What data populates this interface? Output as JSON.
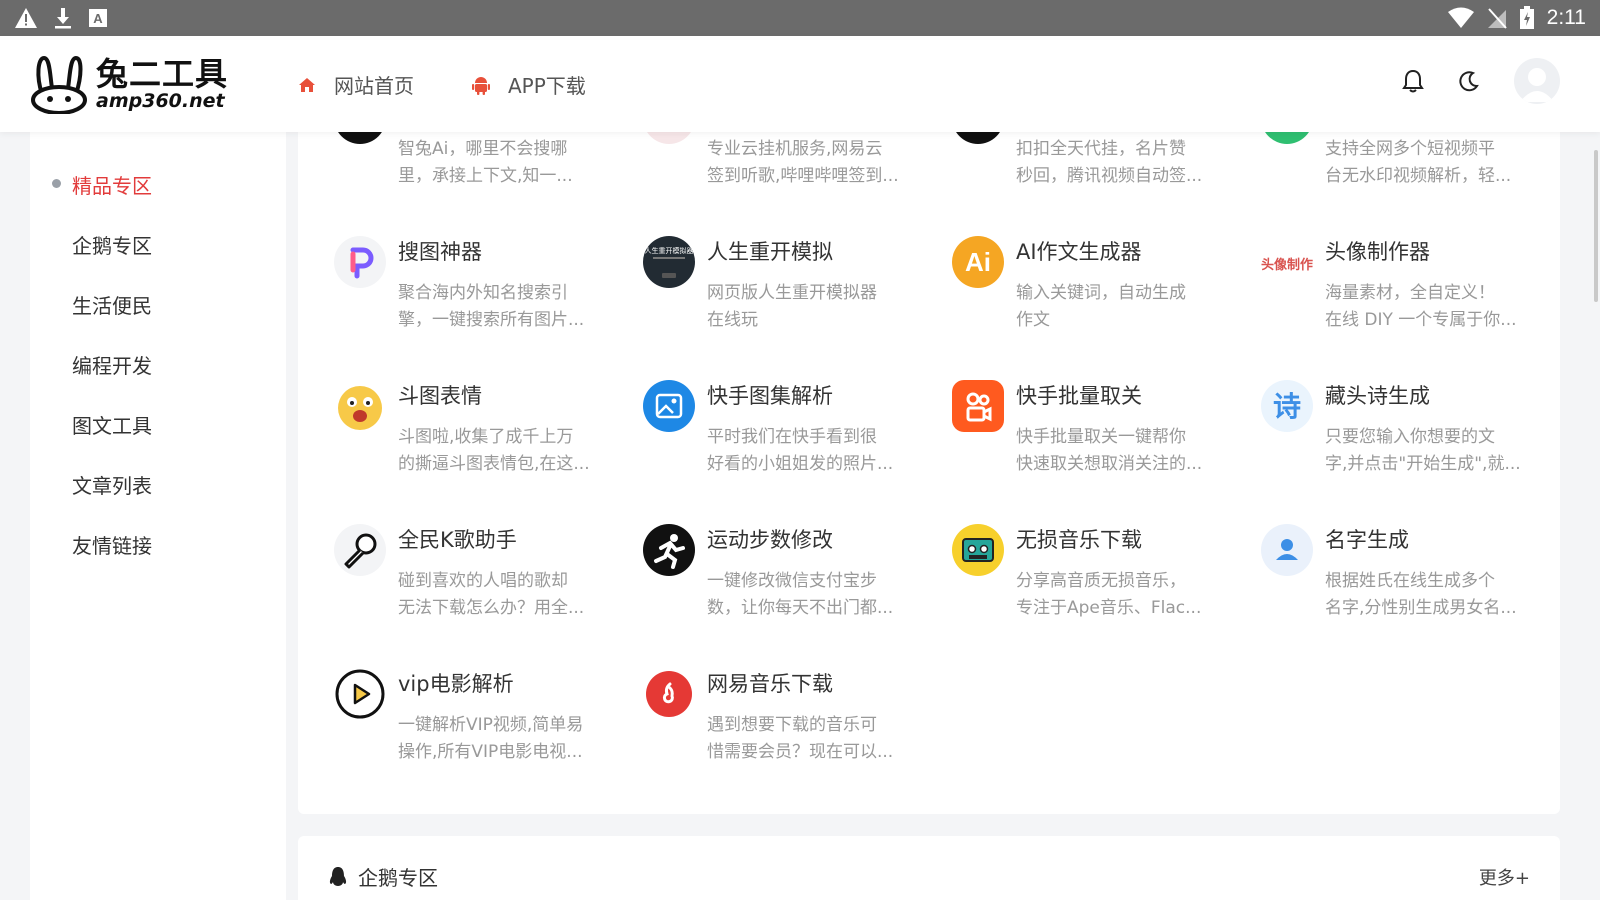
{
  "status_bar": {
    "time": "2:11"
  },
  "header": {
    "logo_cn": "兔二工具",
    "logo_en": "amp360.net",
    "nav": [
      {
        "label": "网站首页",
        "icon": "home-icon"
      },
      {
        "label": "APP下载",
        "icon": "android-icon"
      }
    ]
  },
  "sidebar": {
    "items": [
      {
        "label": "精品专区",
        "active": true
      },
      {
        "label": "企鹅专区"
      },
      {
        "label": "生活便民"
      },
      {
        "label": "编程开发"
      },
      {
        "label": "图文工具"
      },
      {
        "label": "文章列表"
      },
      {
        "label": "友情链接"
      }
    ]
  },
  "tools": [
    {
      "title": "",
      "desc1": "智兔Ai，哪里不会搜哪",
      "desc2": "里，承接上下文,知一..."
    },
    {
      "title": "",
      "desc1": "专业云挂机服务,网易云",
      "desc2": "签到听歌,哔哩哔哩签到..."
    },
    {
      "title": "",
      "desc1": "扣扣全天代挂，名片赞",
      "desc2": "秒回，腾讯视频自动签..."
    },
    {
      "title": "",
      "desc1": "支持全网多个短视频平",
      "desc2": "台无水印视频解析，轻..."
    },
    {
      "title": "搜图神器",
      "desc1": "聚合海内外知名搜索引",
      "desc2": "擎，一键搜索所有图片..."
    },
    {
      "title": "人生重开模拟",
      "desc1": "网页版人生重开模拟器",
      "desc2": "在线玩"
    },
    {
      "title": "AI作文生成器",
      "desc1": "输入关键词，自动生成",
      "desc2": "作文"
    },
    {
      "title": "头像制作器",
      "desc1": "海量素材，全自定义！",
      "desc2": "在线 DIY 一个专属于你..."
    },
    {
      "title": "斗图表情",
      "desc1": "斗图啦,收集了成千上万",
      "desc2": "的撕逼斗图表情包,在这..."
    },
    {
      "title": "快手图集解析",
      "desc1": "平时我们在快手看到很",
      "desc2": "好看的小姐姐发的照片..."
    },
    {
      "title": "快手批量取关",
      "desc1": "快手批量取关一键帮你",
      "desc2": "快速取关想取消关注的..."
    },
    {
      "title": "藏头诗生成",
      "desc1": "只要您输入你想要的文",
      "desc2": "字,并点击\"开始生成\",就..."
    },
    {
      "title": "全民K歌助手",
      "desc1": "碰到喜欢的人唱的歌却",
      "desc2": "无法下载怎么办？用全..."
    },
    {
      "title": "运动步数修改",
      "desc1": "一键修改微信支付宝步",
      "desc2": "数，让你每天不出门都..."
    },
    {
      "title": "无损音乐下载",
      "desc1": "分享高音质无损音乐，",
      "desc2": "专注于Ape音乐、Flac..."
    },
    {
      "title": "名字生成",
      "desc1": "根据姓氏在线生成多个",
      "desc2": "名字,分性别生成男女名..."
    },
    {
      "title": "vip电影解析",
      "desc1": "一键解析VIP视频,简单易",
      "desc2": "操作,所有VIP电影电视..."
    },
    {
      "title": "网易音乐下载",
      "desc1": "遇到想要下载的音乐可",
      "desc2": "惜需要会员？现在可以..."
    }
  ],
  "icon_text": {
    "ai": "Ai",
    "poem": "诗",
    "avatar_maker": "头像制作",
    "rensheng": "人生重开模拟器"
  },
  "section2": {
    "title": "企鹅专区",
    "more": "更多+"
  },
  "colors": {
    "accent": "#e23b3b",
    "text": "#333333",
    "muted": "#999999"
  }
}
